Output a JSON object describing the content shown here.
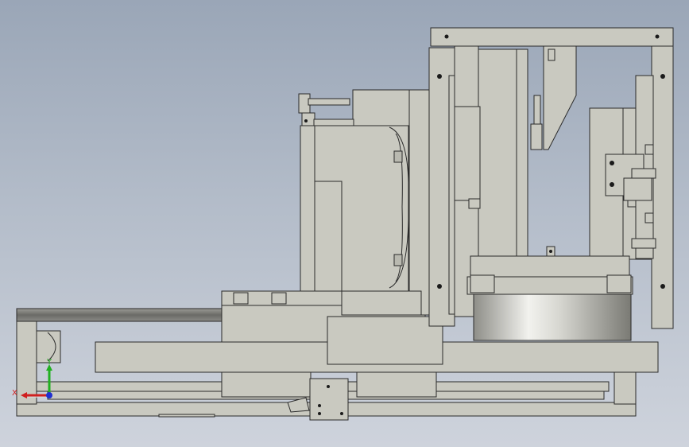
{
  "viewer": {
    "background_top": "#9aa6b7",
    "background_bottom": "#ced3dc",
    "part_color": "#c9c9c0",
    "edge_color": "#2a2a2a"
  },
  "triad": {
    "x_label": "X",
    "y_label": "Y",
    "x_color": "#d02020",
    "y_color": "#20b020",
    "z_color": "#2030d0"
  }
}
